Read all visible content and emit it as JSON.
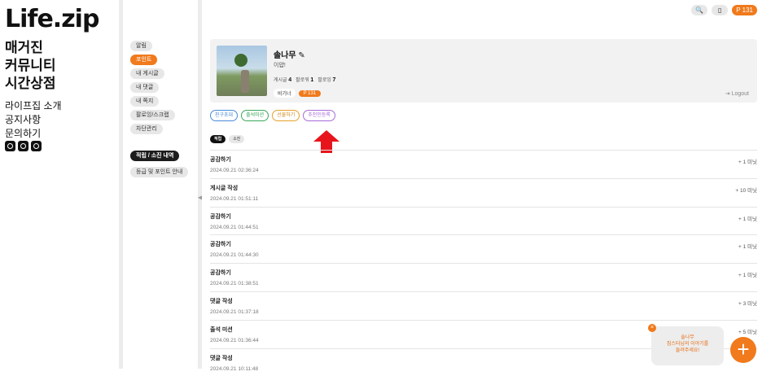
{
  "brand": {
    "logo": "Life.zip"
  },
  "main_menu": [
    "매거진",
    "커뮤니티",
    "시간상점"
  ],
  "sub_menu": [
    "라이프집 소개",
    "공지사항",
    "문의하기"
  ],
  "social_icons": [
    "chat-icon",
    "instagram-icon",
    "youtube-icon"
  ],
  "mypage_menu": {
    "items": [
      "알림",
      "포인트",
      "내 게시글",
      "내 댓글",
      "내 쪽지",
      "팔로잉/스크랩",
      "차단관리"
    ],
    "active": "포인트",
    "history_button": "적립 / 소진 내역",
    "guide_button": "등급 및 포인트 안내"
  },
  "top_bar": {
    "point_badge": "131"
  },
  "profile": {
    "name": "솔나무",
    "intro": "이얍!",
    "stats": [
      {
        "label": "게시글",
        "value": "4"
      },
      {
        "label": "팔로워",
        "value": "1"
      },
      {
        "label": "팔로잉",
        "value": "7"
      }
    ],
    "grade": "비기너",
    "points": "131",
    "logout": "Logout"
  },
  "actions": [
    "친구초대",
    "출석미션",
    "선물하기",
    "추천인등록"
  ],
  "filters": [
    "적립",
    "소진"
  ],
  "history": [
    {
      "title": "공감하기",
      "date": "2024.09.21 02:36:24",
      "amount": "+ 1 미닛"
    },
    {
      "title": "게시글 작성",
      "date": "2024.09.21 01:51:11",
      "amount": "+ 10 미닛"
    },
    {
      "title": "공감하기",
      "date": "2024.09.21 01:44:51",
      "amount": "+ 1 미닛"
    },
    {
      "title": "공감하기",
      "date": "2024.09.21 01:44:30",
      "amount": "+ 1 미닛"
    },
    {
      "title": "공감하기",
      "date": "2024.09.21 01:38:51",
      "amount": "+ 1 미닛"
    },
    {
      "title": "댓글 작성",
      "date": "2024.09.21 01:37:18",
      "amount": "+ 3 미닛"
    },
    {
      "title": "출석 미션",
      "date": "2024.09.21 01:36:44",
      "amount": "+ 5 미닛"
    },
    {
      "title": "댓글 작성",
      "date": "2024.09.21 10:11:48",
      "amount": ""
    }
  ],
  "toast": {
    "line1": "솔나무",
    "line2": "집스터님의 이야기를",
    "line3": "들려주세요!"
  },
  "fab": {
    "label": "+"
  },
  "colors": {
    "accent": "#f07a1c",
    "text": "#222222"
  }
}
